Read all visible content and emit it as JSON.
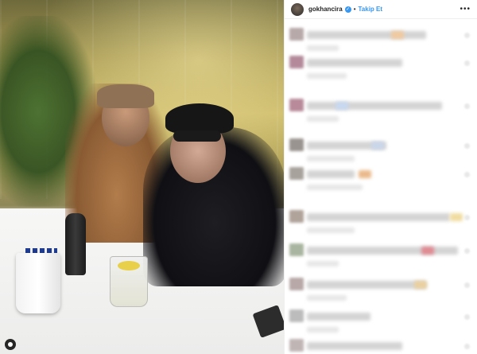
{
  "post": {
    "username": "gokhancira",
    "follow_label": "Takip Et",
    "more_label": "•••",
    "verified_label": "✓",
    "separator": "•"
  },
  "colors": {
    "accent_blue": "#3897f0",
    "text_dark": "#262626",
    "blur_gray": "#d4d4d4"
  },
  "icons": {
    "verified": "verified-badge-icon",
    "more": "more-options-icon",
    "user_tag": "user-tag-icon"
  },
  "comments": [
    {
      "avatar_color": "#b7a9a9",
      "accent_color": "#f0c9a0"
    },
    {
      "avatar_color": "#b48a9a",
      "accent_color": ""
    },
    {
      "avatar_color": "#b88a9a",
      "accent_color": "#c7d8f0"
    },
    {
      "avatar_color": "#9a9490",
      "accent_color": "#c9d6ea"
    },
    {
      "avatar_color": "#a8a29c",
      "accent_color": "#eab98a"
    },
    {
      "avatar_color": "#b0a39a",
      "accent_color": "#f0dca0"
    },
    {
      "avatar_color": "#a9b5a0",
      "accent_color": "#e08a92"
    },
    {
      "avatar_color": "#b8a8a8",
      "accent_color": "#ead0a0"
    },
    {
      "avatar_color": "#bcbcbc",
      "accent_color": ""
    },
    {
      "avatar_color": "#c0b5b5",
      "accent_color": ""
    }
  ]
}
